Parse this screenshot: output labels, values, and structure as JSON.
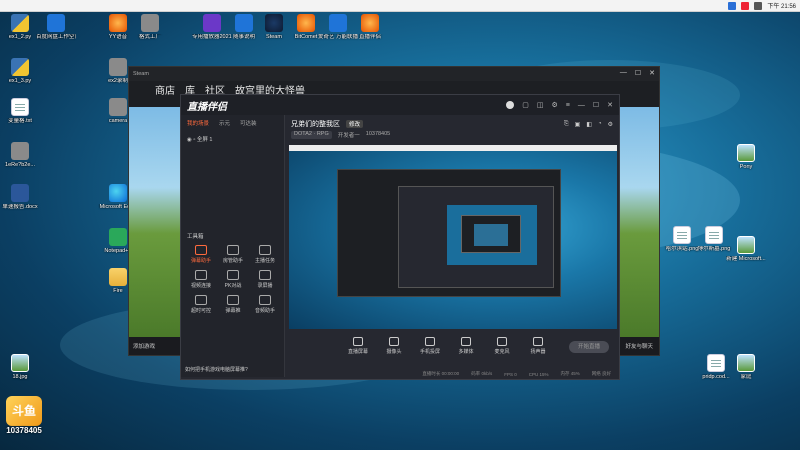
{
  "taskbar": {
    "time": "下午 21:56"
  },
  "desktop_icons": [
    {
      "label": "ex1_2.py",
      "type": "py"
    },
    {
      "label": "百度网盘工作空间",
      "type": "blue"
    },
    {
      "label": "YY语音",
      "type": "orange"
    },
    {
      "label": "格式工厂",
      "type": "gray"
    },
    {
      "label": "专用播放器2021.exe",
      "type": "purple"
    },
    {
      "label": "随事说明",
      "type": "blue"
    },
    {
      "label": "Steam",
      "type": "steam"
    },
    {
      "label": "BitComet",
      "type": "orange"
    },
    {
      "label": "爱奇艺 万能联播",
      "type": "blue"
    },
    {
      "label": "直播伴侣",
      "type": "orange"
    },
    {
      "label": "ex1_3.py",
      "type": "py"
    },
    {
      "label": "ex2录制",
      "type": "gray"
    },
    {
      "label": "变量格.txt",
      "type": "doc"
    },
    {
      "label": "camera",
      "type": "gray"
    },
    {
      "label": "1eRe?b2e...",
      "type": "gray"
    },
    {
      "label": "单速报告.docx",
      "type": "word"
    },
    {
      "label": "Microsoft Edge",
      "type": "edge"
    },
    {
      "label": "Notepad++",
      "type": "green"
    },
    {
      "label": "Fire",
      "type": "folder"
    },
    {
      "label": "18.jpg",
      "type": "img"
    },
    {
      "label": "Pony",
      "type": "img"
    },
    {
      "label": "哈尔滨站.png",
      "type": "doc"
    },
    {
      "label": "博尔斯墓.png",
      "type": "doc"
    },
    {
      "label": "新建 Microsoft...",
      "type": "img"
    },
    {
      "label": "pridp.cod...",
      "type": "doc"
    },
    {
      "label": "家庭",
      "type": "img"
    }
  ],
  "window": {
    "title": "Steam",
    "nav": [
      "商店",
      "库",
      "社区",
      "故宫里的大怪兽"
    ],
    "bottom_left": "添加游戏",
    "bottom_right": "好友与聊天"
  },
  "panel": {
    "logo": "直播伴侣",
    "tabs": [
      "我的场景",
      "示元",
      "可达装"
    ],
    "scene_item": "全屏 1",
    "tools_title": "工具箱",
    "tools": [
      {
        "label": "弹幕助手",
        "hot": true
      },
      {
        "label": "房管助手",
        "hot": false
      },
      {
        "label": "主播任务",
        "hot": false
      },
      {
        "label": "视频连接",
        "hot": false
      },
      {
        "label": "PK对战",
        "hot": false
      },
      {
        "label": "录屏播",
        "hot": false
      },
      {
        "label": "超时可控",
        "hot": false
      },
      {
        "label": "弹幕推",
        "hot": false
      },
      {
        "label": "音频助手",
        "hot": false
      }
    ],
    "hint": "如何把手机游戏电脑屏幕推?",
    "room_title": "兄弟们的整我区",
    "room_badge": "修改",
    "category": "DOTA2 · RPG",
    "host": "开发者一",
    "room_id": "10378405",
    "controls": [
      "直播屏幕",
      "摄像头",
      "手机投屏",
      "多媒体",
      "麦克风",
      "扬声器"
    ],
    "go_live": "开始直播",
    "status": [
      "直播时长 00:00:00",
      "码率 0kb/s",
      "FPS 0",
      "CPU 15%",
      "内存 45%",
      "网络 良好"
    ]
  },
  "watermark": {
    "logo": "斗鱼",
    "room_id": "10378405"
  }
}
